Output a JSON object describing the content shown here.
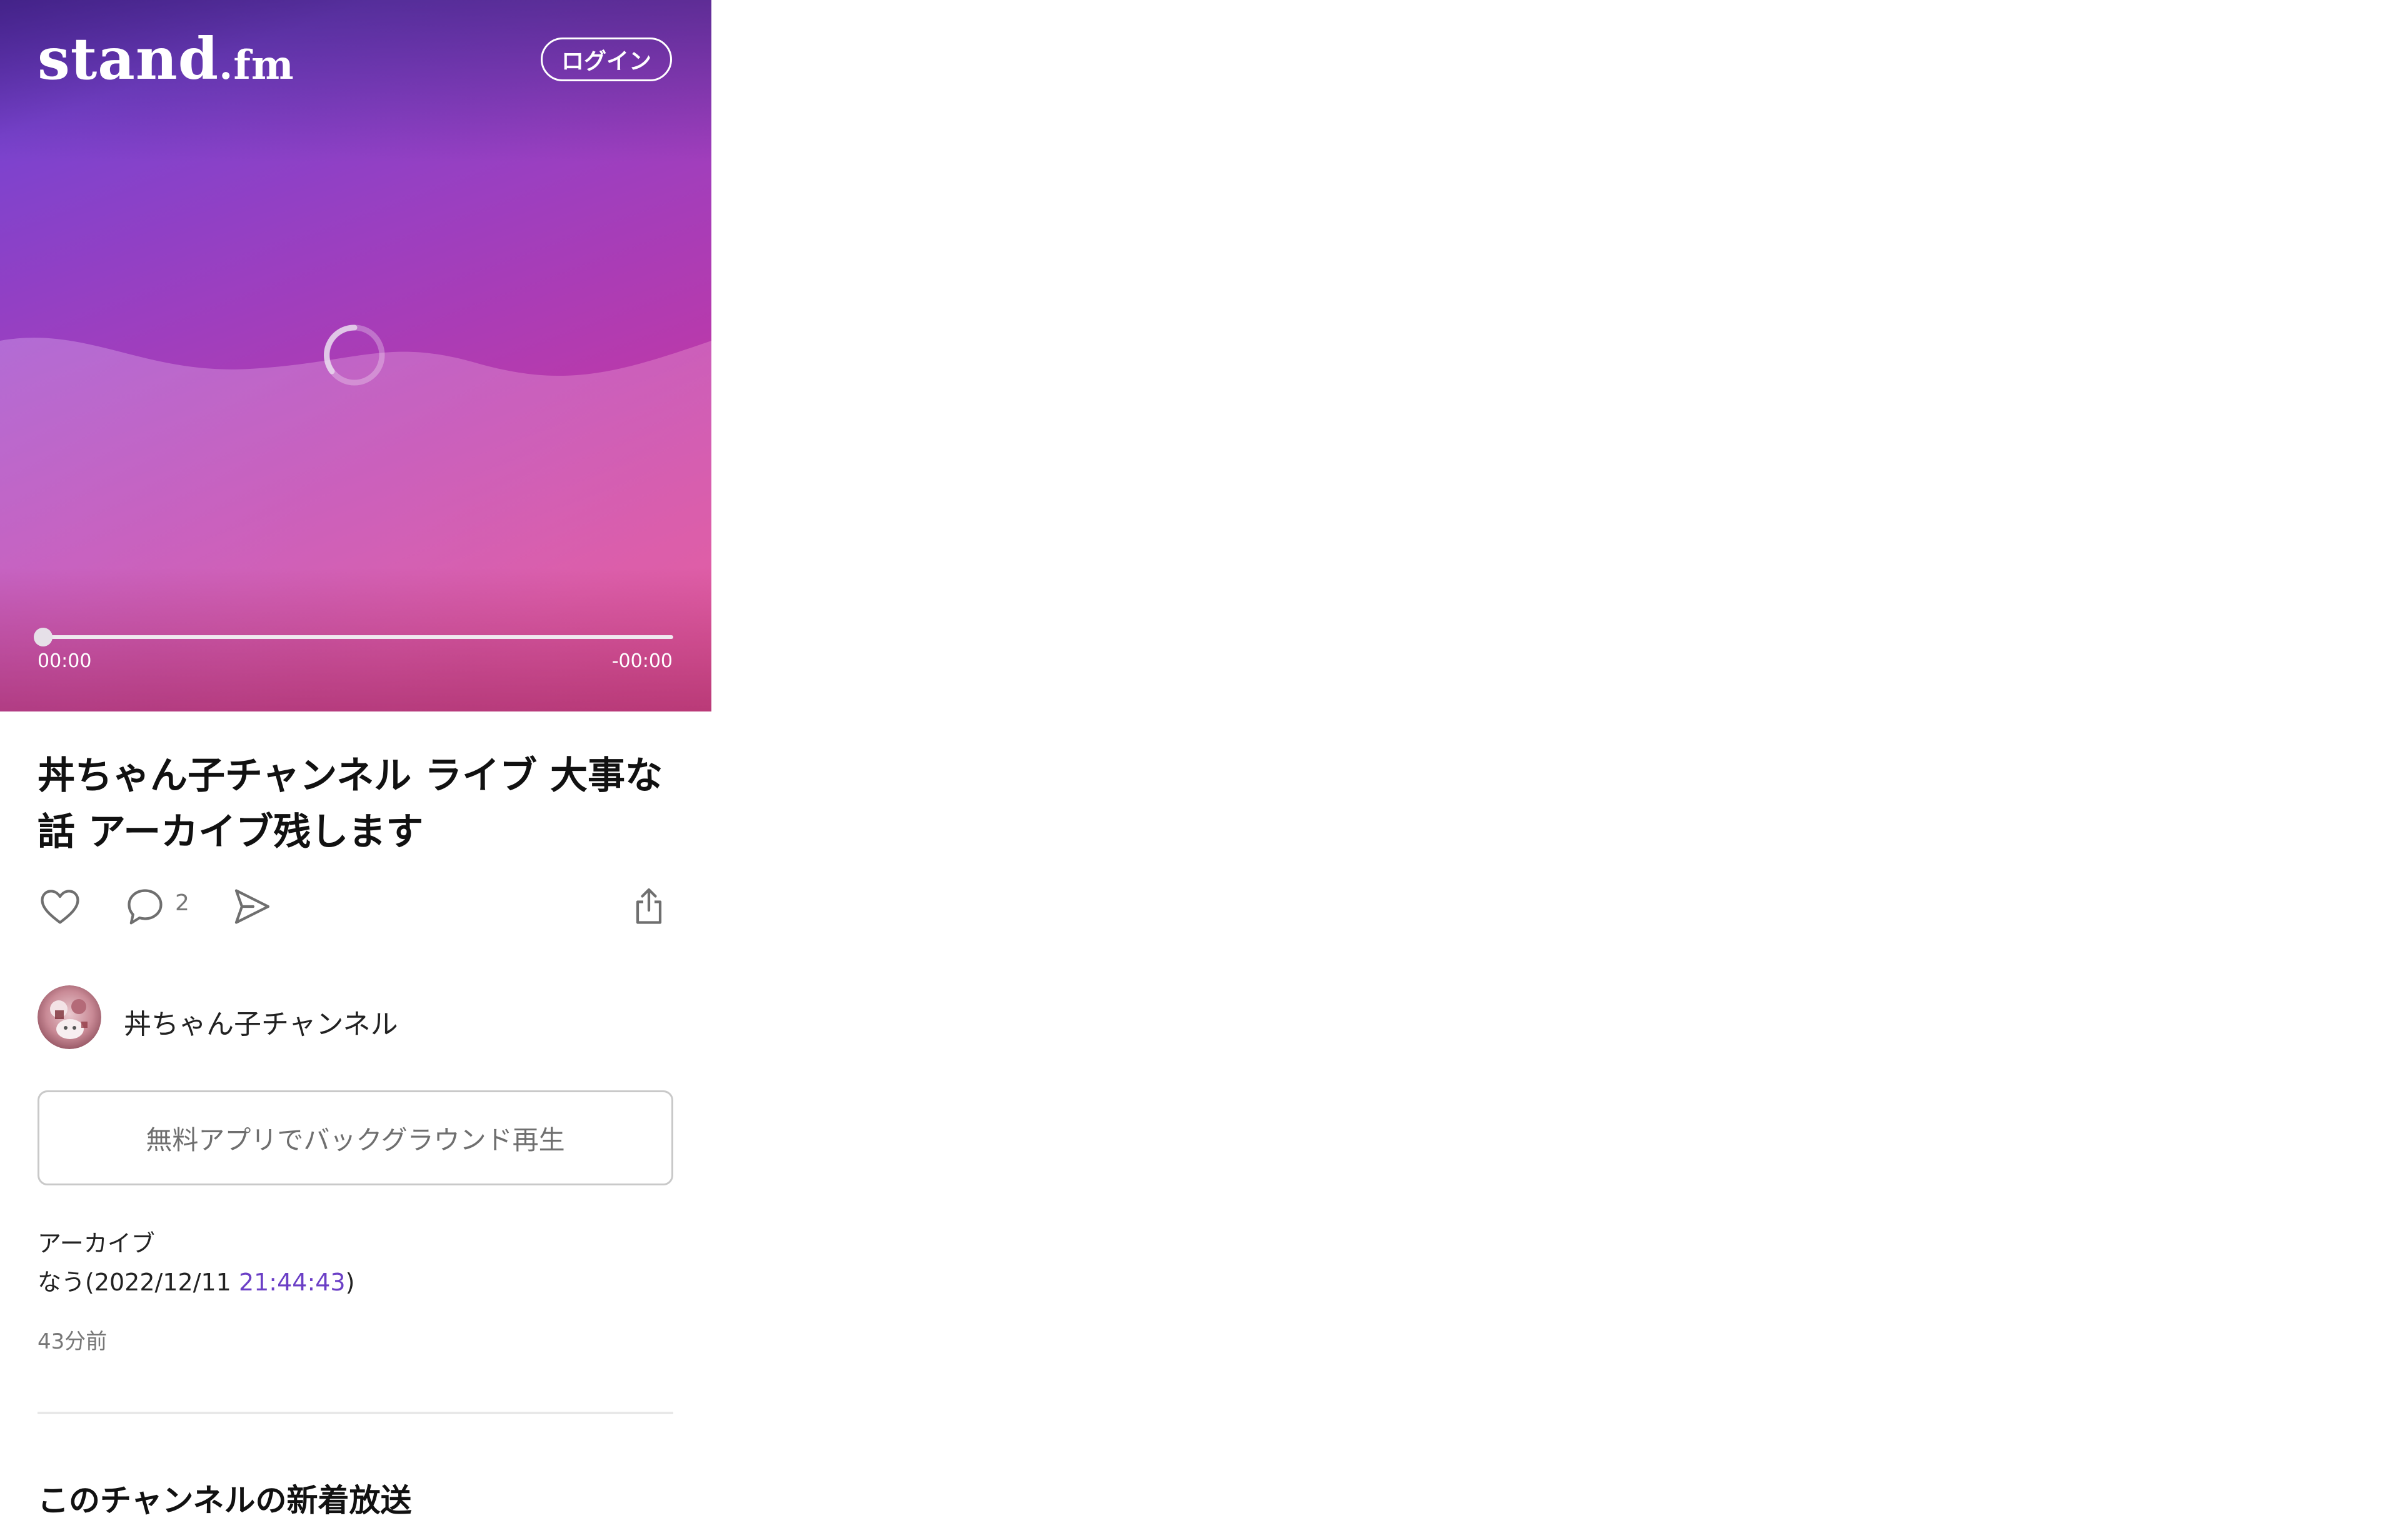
{
  "brand": {
    "logo_main": "stand",
    "logo_suffix": ".fm",
    "accent_color": "#6b3fc6",
    "gradient_colors": [
      "#5a2fb0",
      "#9b3fc0",
      "#d0449a"
    ]
  },
  "header": {
    "login_label": "ログイン"
  },
  "player": {
    "current_time": "00:00",
    "remaining_time": "-00:00",
    "progress": 0.0,
    "state": "loading"
  },
  "episode": {
    "title": "丼ちゃん子チャンネル ライブ   大事な話  アーカイブ残します",
    "comment_count": "2",
    "description_line1": "アーカイブ",
    "description_prefix": "なう(2022/12/11 ",
    "description_time": "21:44:43",
    "description_suffix": ")",
    "posted_ago": "43分前"
  },
  "actions": {
    "like_icon": "heart-icon",
    "comment_icon": "comment-icon",
    "send_icon": "send-icon",
    "share_icon": "share-icon"
  },
  "channel": {
    "name": "丼ちゃん子チャンネル"
  },
  "app_button": {
    "label": "無料アプリでバックグラウンド再生"
  },
  "sections": {
    "new_broadcasts_title": "このチャンネルの新着放送"
  }
}
